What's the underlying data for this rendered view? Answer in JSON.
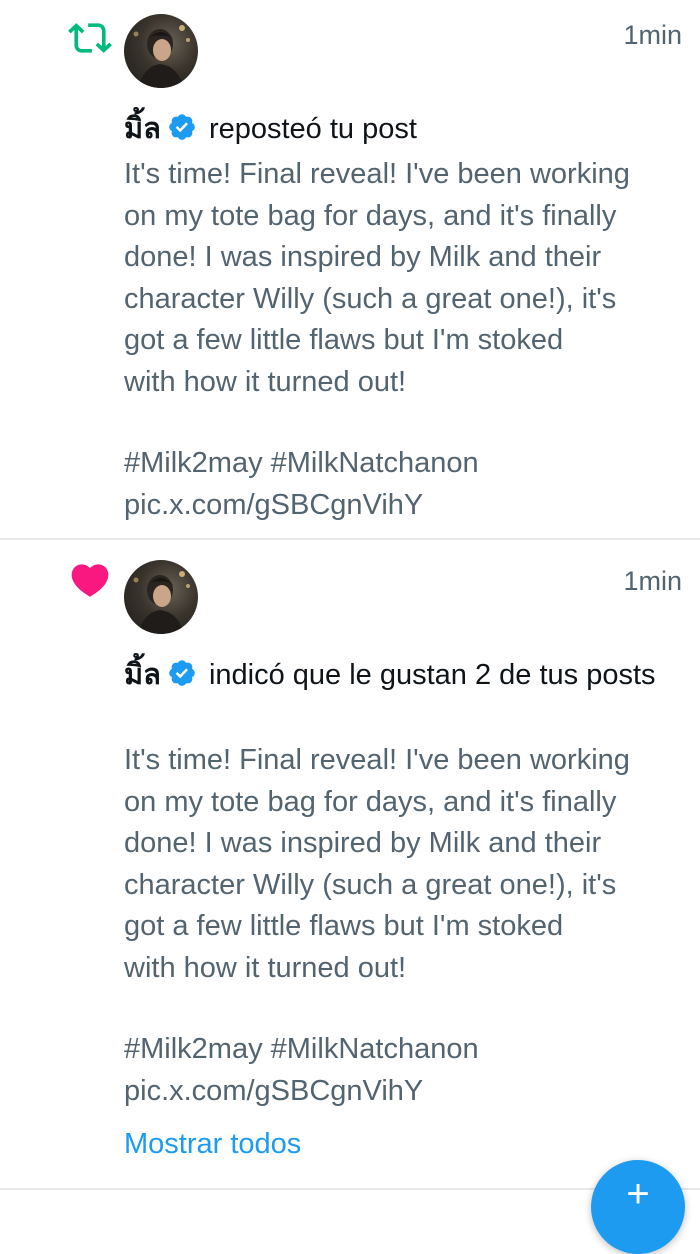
{
  "notifications": [
    {
      "type": "repost",
      "icon": "repost-icon",
      "icon_color": "#00ba7c",
      "time": "1min",
      "user_name": "มิ้ล",
      "action": "reposteó tu post",
      "post_text": "It's time! Final reveal! I've been working\non my tote bag for days, and it's finally\ndone! I was inspired by Milk and their\ncharacter Willy (such a great one!), it's\ngot a few little flaws but I'm stoked\nwith how it turned out!",
      "hashtags": "#Milk2may #MilkNatchanon",
      "link": "pic.x.com/gSBCgnVihY"
    },
    {
      "type": "like",
      "icon": "heart-icon",
      "icon_color": "#f91880",
      "time": "1min",
      "user_name": "มิ้ล",
      "action": "indicó que le gustan 2 de tus posts",
      "post_text": "It's time! Final reveal! I've been working\non my tote bag for days, and it's finally\ndone! I was inspired by Milk and their\ncharacter Willy (such a great one!), it's\ngot a few little flaws but I'm stoked\nwith how it turned out!",
      "hashtags": "#Milk2may #MilkNatchanon",
      "link": "pic.x.com/gSBCgnVihY",
      "show_all": "Mostrar todos"
    }
  ],
  "fab": {
    "icon": "plus-icon",
    "label": "+"
  },
  "colors": {
    "accent": "#1d9bf0",
    "secondary_text": "#536471",
    "verified": "#1d9bf0"
  }
}
